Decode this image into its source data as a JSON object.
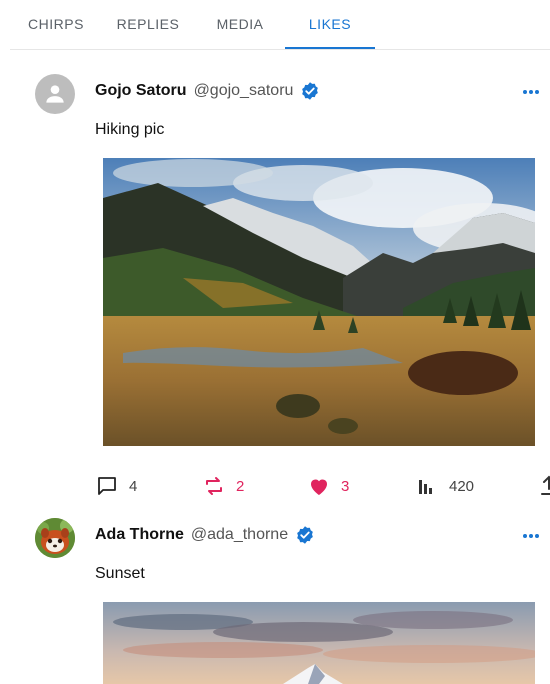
{
  "tabs": [
    {
      "label": "CHIRPS",
      "active": false
    },
    {
      "label": "REPLIES",
      "active": false
    },
    {
      "label": "MEDIA",
      "active": false
    },
    {
      "label": "LIKES",
      "active": true
    }
  ],
  "accent_color": "#1976d2",
  "like_color": "#e0245e",
  "posts": [
    {
      "name": "Gojo Satoru",
      "handle": "@gojo_satoru",
      "verified": true,
      "text": "Hiking pic",
      "image": "mountain valley landscape",
      "actions": {
        "replies": "4",
        "rechirps": "2",
        "likes": "3",
        "views": "420"
      }
    },
    {
      "name": "Ada Thorne",
      "handle": "@ada_thorne",
      "verified": true,
      "text": "Sunset",
      "image": "snowy peak at sunset"
    }
  ]
}
